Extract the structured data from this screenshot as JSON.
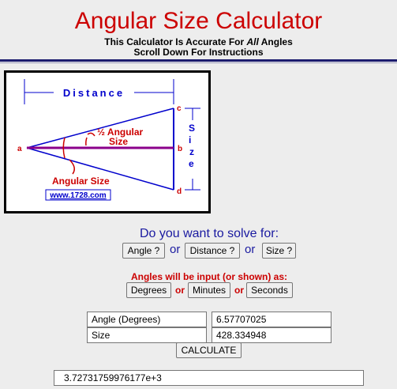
{
  "header": {
    "title": "Angular Size Calculator",
    "subtitle_prefix": "This Calculator Is Accurate For ",
    "subtitle_emph": "All",
    "subtitle_suffix": " Angles",
    "instructions": "Scroll Down For Instructions"
  },
  "diagram": {
    "distance_label": "Distance",
    "half_angle_label_1": "½ Angular",
    "half_angle_label_2": "Size",
    "angular_size_label": "Angular Size",
    "size_label": "Size",
    "point_a": "a",
    "point_b": "b",
    "point_c": "c",
    "point_d": "d",
    "website": "www.1728.com",
    "colors": {
      "line": "#0000cc",
      "label": "#cc0000",
      "axis": "#8b008b"
    }
  },
  "solve": {
    "question": "Do you want to solve for:",
    "angle_button": "Angle ?",
    "distance_button": "Distance ?",
    "size_button": "Size ?",
    "or": "or"
  },
  "units": {
    "label": "Angles will be input (or shown) as:",
    "degrees_button": "Degrees",
    "minutes_button": "Minutes",
    "seconds_button": "Seconds",
    "or": "or"
  },
  "inputs": {
    "angle_label": "Angle (Degrees)",
    "angle_value": "6.57707025",
    "size_label": "Size",
    "size_value": "428.334948",
    "calculate_button": "CALCULATE"
  },
  "result": {
    "value": "3.72731759976177e+3"
  }
}
